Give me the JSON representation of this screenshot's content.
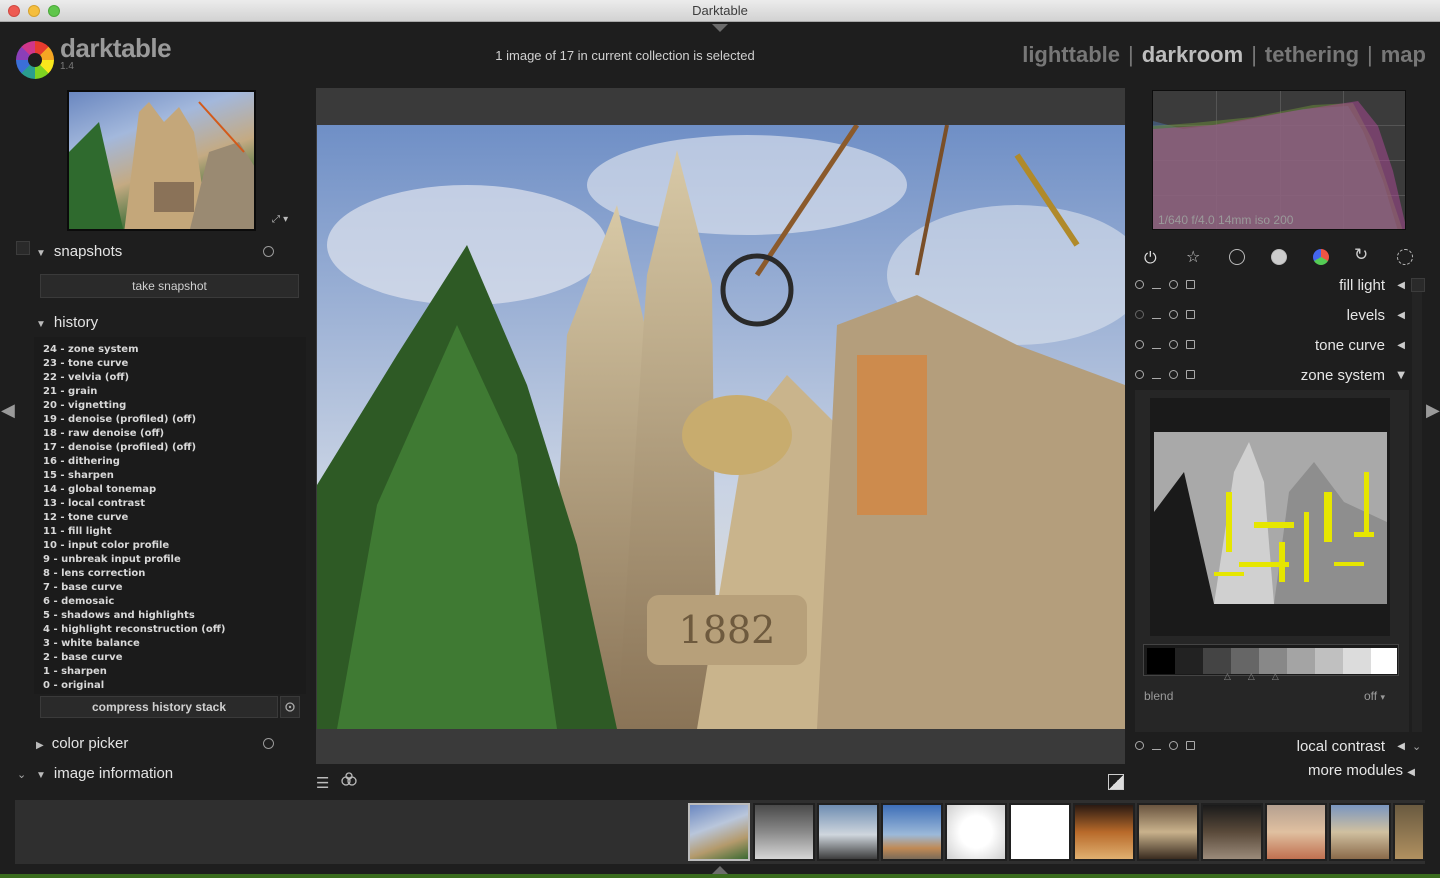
{
  "window": {
    "title": "Darktable"
  },
  "app": {
    "name": "darktable",
    "version": "1.4"
  },
  "header": {
    "selection_status": "1 image of 17 in current collection is selected",
    "views": [
      {
        "label": "lighttable",
        "active": false
      },
      {
        "label": "darkroom",
        "active": true
      },
      {
        "label": "tethering",
        "active": false
      },
      {
        "label": "map",
        "active": false
      }
    ]
  },
  "left": {
    "snapshots": {
      "title": "snapshots",
      "take_label": "take snapshot"
    },
    "history": {
      "title": "history",
      "items": [
        "24 - zone system",
        "23 - tone curve",
        "22 - velvia  (off)",
        "21 - grain",
        "20 - vignetting",
        "19 - denoise (profiled)  (off)",
        "18 - raw denoise  (off)",
        "17 - denoise (profiled)  (off)",
        "16 - dithering",
        "15 - sharpen",
        "14 - global tonemap",
        "13 - local contrast",
        "12 - tone curve",
        "11 - fill light",
        "10 - input color profile",
        "9 - unbreak input profile",
        "8 - lens correction",
        "7 - base curve",
        "6 - demosaic",
        "5 - shadows and highlights",
        "4 - highlight reconstruction  (off)",
        "3 - white balance",
        "2 - base curve",
        "1 - sharpen",
        "0 - original"
      ],
      "compress_label": "compress history stack"
    },
    "color_picker": {
      "title": "color picker"
    },
    "image_information": {
      "title": "image information"
    }
  },
  "right": {
    "histogram": {
      "exif": "1/640 f/4.0 14mm iso 200"
    },
    "modules": [
      {
        "name": "fill light"
      },
      {
        "name": "levels"
      },
      {
        "name": "tone curve"
      },
      {
        "name": "zone system"
      }
    ],
    "zone_system": {
      "blend_label": "blend",
      "blend_value": "off"
    },
    "local_contrast": {
      "name": "local contrast"
    },
    "more_modules": "more modules"
  },
  "colors": {
    "background": "#1e1e1e",
    "panel": "#2f2f2f",
    "text": "#e4e4e4",
    "zone_highlight": "#e6e600"
  },
  "icons": [
    "power-icon",
    "star-icon",
    "circle-icon",
    "filled-circle-icon",
    "color-wheel-icon",
    "rotate-icon",
    "palette-icon",
    "settings-icon"
  ]
}
